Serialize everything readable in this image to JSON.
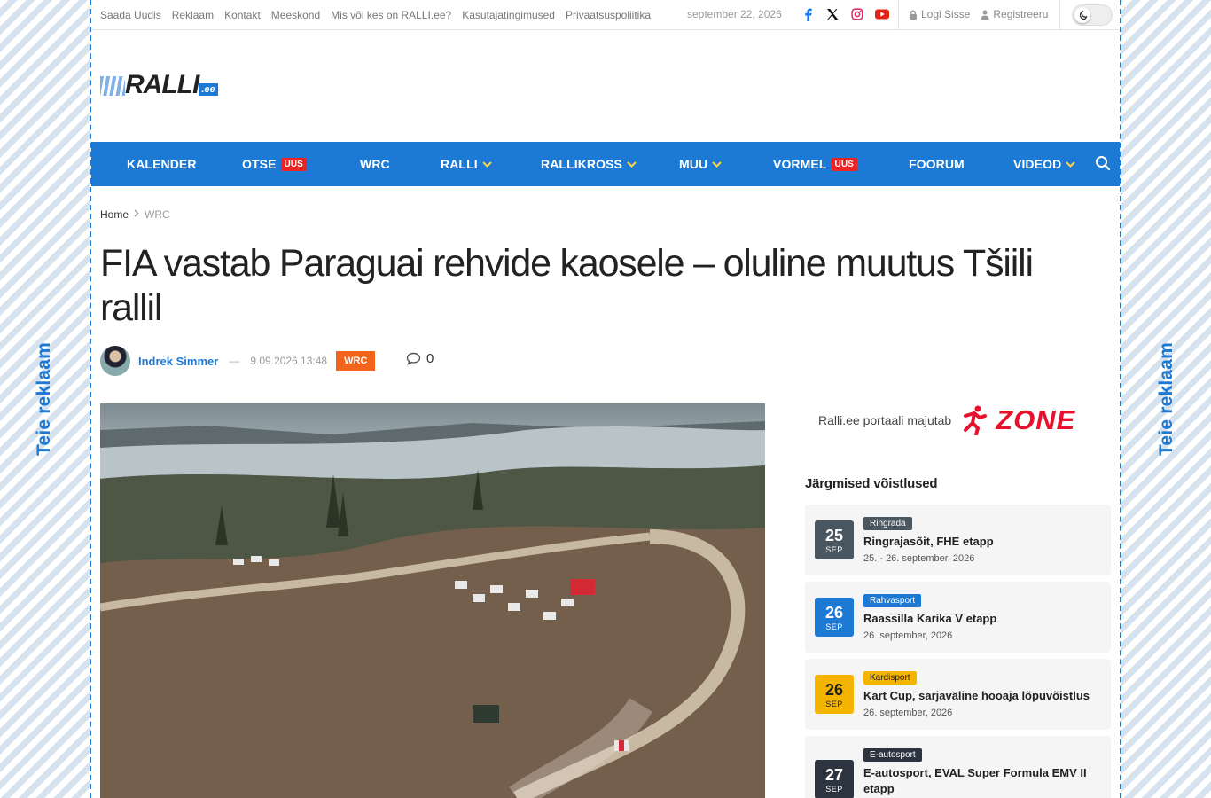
{
  "side_ads": {
    "left": "Teie reklaam",
    "right": "Teie reklaam"
  },
  "topbar": {
    "links": [
      "Saada Uudis",
      "Reklaam",
      "Kontakt",
      "Meeskond",
      "Mis või kes on RALLI.ee?",
      "Kasutajatingimused",
      "Privaatsuspoliitika"
    ],
    "date": "september 22, 2026",
    "login": "Logi Sisse",
    "register": "Registreeru"
  },
  "logo": {
    "word": "RALLI",
    "tld": ".ee"
  },
  "nav": {
    "items": [
      {
        "label": "KALENDER"
      },
      {
        "label": "OTSE",
        "badge": "UUS"
      },
      {
        "label": "WRC"
      },
      {
        "label": "RALLI",
        "dropdown": true
      },
      {
        "label": "RALLIKROSS",
        "dropdown": true
      },
      {
        "label": "MUU",
        "dropdown": true
      },
      {
        "label": "VORMEL",
        "badge": "UUS"
      },
      {
        "label": "FOORUM"
      },
      {
        "label": "VIDEOD",
        "dropdown": true
      }
    ]
  },
  "breadcrumb": {
    "home": "Home",
    "current": "WRC"
  },
  "article": {
    "title": "FIA vastab Paraguai rehvide kaosele – oluline muutus Tšiili rallil",
    "author": "Indrek Simmer",
    "dash": "—",
    "date": "9.09.2026 13:48",
    "category": "WRC",
    "comments": "0"
  },
  "sidebar": {
    "host_text": "Ralli.ee portaali majutab",
    "host_brand": "ZONE",
    "upcoming_title": "Järgmised võistlused",
    "events": [
      {
        "day": "25",
        "month": "SEP",
        "tag": "Ringrada",
        "name": "Ringrajasõit, FHE etapp",
        "when": "25. - 26. september, 2026",
        "color": "#4a5660",
        "tag_color": "#4a5660"
      },
      {
        "day": "26",
        "month": "SEP",
        "tag": "Rahvasport",
        "name": "Raassilla Karika V etapp",
        "when": "26. september, 2026",
        "color": "#1c7ad4",
        "tag_color": "#1c7ad4"
      },
      {
        "day": "26",
        "month": "SEP",
        "tag": "Kardisport",
        "name": "Kart Cup, sarjaväline hooaja lõpuvõistlus",
        "when": "26. september, 2026",
        "color": "#f5b400",
        "tag_color": "#f5b400"
      },
      {
        "day": "27",
        "month": "SEP",
        "tag": "E-autosport",
        "name": "E-autosport, EVAL Super Formula EMV II etapp",
        "when": "",
        "color": "#2c3440",
        "tag_color": "#2c3440"
      }
    ]
  }
}
